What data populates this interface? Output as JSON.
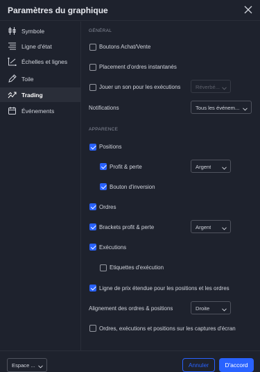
{
  "dialog": {
    "title": "Paramètres du graphique"
  },
  "sidebar": {
    "items": [
      {
        "label": "Symbole",
        "icon": "candlestick-icon"
      },
      {
        "label": "Ligne d'état",
        "icon": "status-line-icon"
      },
      {
        "label": "Échelles et lignes",
        "icon": "scales-icon"
      },
      {
        "label": "Toile",
        "icon": "pencil-icon"
      },
      {
        "label": "Trading",
        "icon": "trading-icon",
        "active": true
      },
      {
        "label": "Événements",
        "icon": "calendar-icon"
      }
    ]
  },
  "general": {
    "heading": "GÉNÉRAL",
    "buy_sell_buttons": {
      "label": "Boutons Achat/Vente",
      "checked": false
    },
    "instant_orders": {
      "label": "Placement d'ordres instantanés",
      "checked": false
    },
    "play_sound": {
      "label": "Jouer un son pour les exécutions",
      "checked": false
    },
    "sound_select": "Réverbé...",
    "notifications_label": "Notifications",
    "notifications_select": "Tous les événem..."
  },
  "appearance": {
    "heading": "APPARENCE",
    "positions": {
      "label": "Positions",
      "checked": true
    },
    "profit_loss": {
      "label": "Profit & perte",
      "checked": true
    },
    "profit_loss_select": "Argent",
    "reverse_button": {
      "label": "Bouton d'inversion",
      "checked": true
    },
    "orders": {
      "label": "Ordres",
      "checked": true
    },
    "brackets": {
      "label": "Brackets profit & perte",
      "checked": true
    },
    "brackets_select": "Argent",
    "executions": {
      "label": "Exécutions",
      "checked": true
    },
    "execution_labels": {
      "label": "Etiquettes d'exécution",
      "checked": false
    },
    "extended_price_line": {
      "label": "Ligne de prix étendue pour les positions et les ordres",
      "checked": true
    },
    "alignment_label": "Alignement des ordres & positions",
    "alignment_select": "Droite",
    "screenshots": {
      "label": "Ordres, exécutions et positions sur les captures d'écran",
      "checked": false
    }
  },
  "footer": {
    "template_select": "Espace ...",
    "cancel_label": "Annuler",
    "ok_label": "D'accord"
  },
  "colors": {
    "accent": "#2962ff",
    "background": "#1e222d",
    "active_item": "#2a2e39"
  }
}
